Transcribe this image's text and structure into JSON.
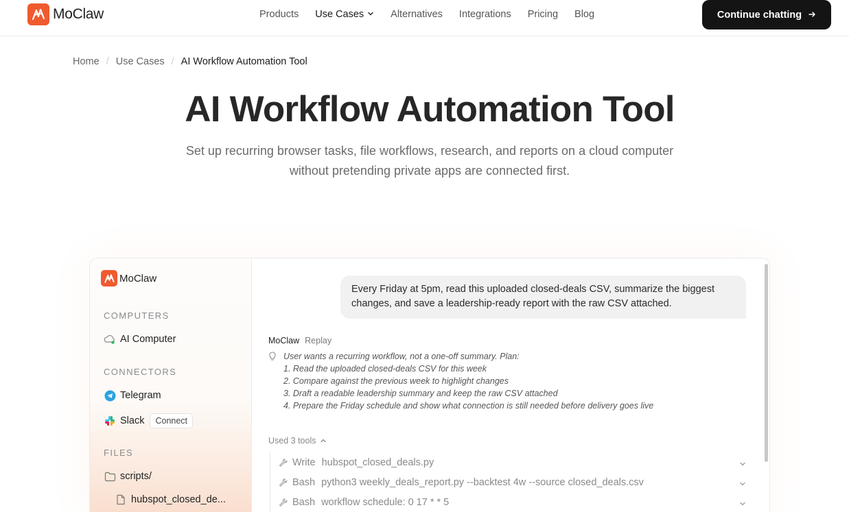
{
  "brand": {
    "name": "MoClaw"
  },
  "nav": {
    "links": [
      "Products",
      "Use Cases",
      "Alternatives",
      "Integrations",
      "Pricing",
      "Blog"
    ],
    "cta_label": "Continue chatting"
  },
  "breadcrumb": [
    "Home",
    "Use Cases",
    "AI Workflow Automation Tool"
  ],
  "hero": {
    "title": "AI Workflow Automation Tool",
    "subtitle": "Set up recurring browser tasks, file workflows, research, and reports on a cloud computer without pretending private apps are connected first."
  },
  "demo": {
    "sidebar": {
      "brand": "MoClaw",
      "sections": {
        "computers": "COMPUTERS",
        "connectors": "CONNECTORS",
        "files": "FILES"
      },
      "computer_item": "AI Computer",
      "connectors": [
        {
          "label": "Telegram"
        },
        {
          "label": "Slack",
          "action": "Connect"
        }
      ],
      "files": [
        {
          "label": "scripts/",
          "type": "folder"
        },
        {
          "label": "hubspot_closed_de...",
          "type": "file"
        }
      ]
    },
    "chat": {
      "user_message": "Every Friday at 5pm, read this uploaded closed-deals CSV, summarize the biggest changes, and save a leadership-ready report with the raw CSV attached.",
      "reply_name": "MoClaw",
      "reply_tag": "Replay",
      "thinking": [
        "User wants a recurring workflow, not a one-off summary. Plan:",
        "1. Read the uploaded closed-deals CSV for this week",
        "2. Compare against the previous week to highlight changes",
        "3. Draft a readable leadership summary and keep the raw CSV attached",
        "4. Prepare the Friday schedule and show what connection is still needed before delivery goes live"
      ],
      "tools_label": "Used 3 tools",
      "tools": [
        {
          "name": "Write",
          "arg": "hubspot_closed_deals.py"
        },
        {
          "name": "Bash",
          "arg": "python3 weekly_deals_report.py --backtest 4w --source closed_deals.csv"
        },
        {
          "name": "Bash",
          "arg": "workflow schedule: 0 17 * * 5"
        }
      ]
    }
  },
  "colors": {
    "brand": "#ef5a2f",
    "cta_bg": "#141414",
    "telegram": "#2aa3e0"
  }
}
